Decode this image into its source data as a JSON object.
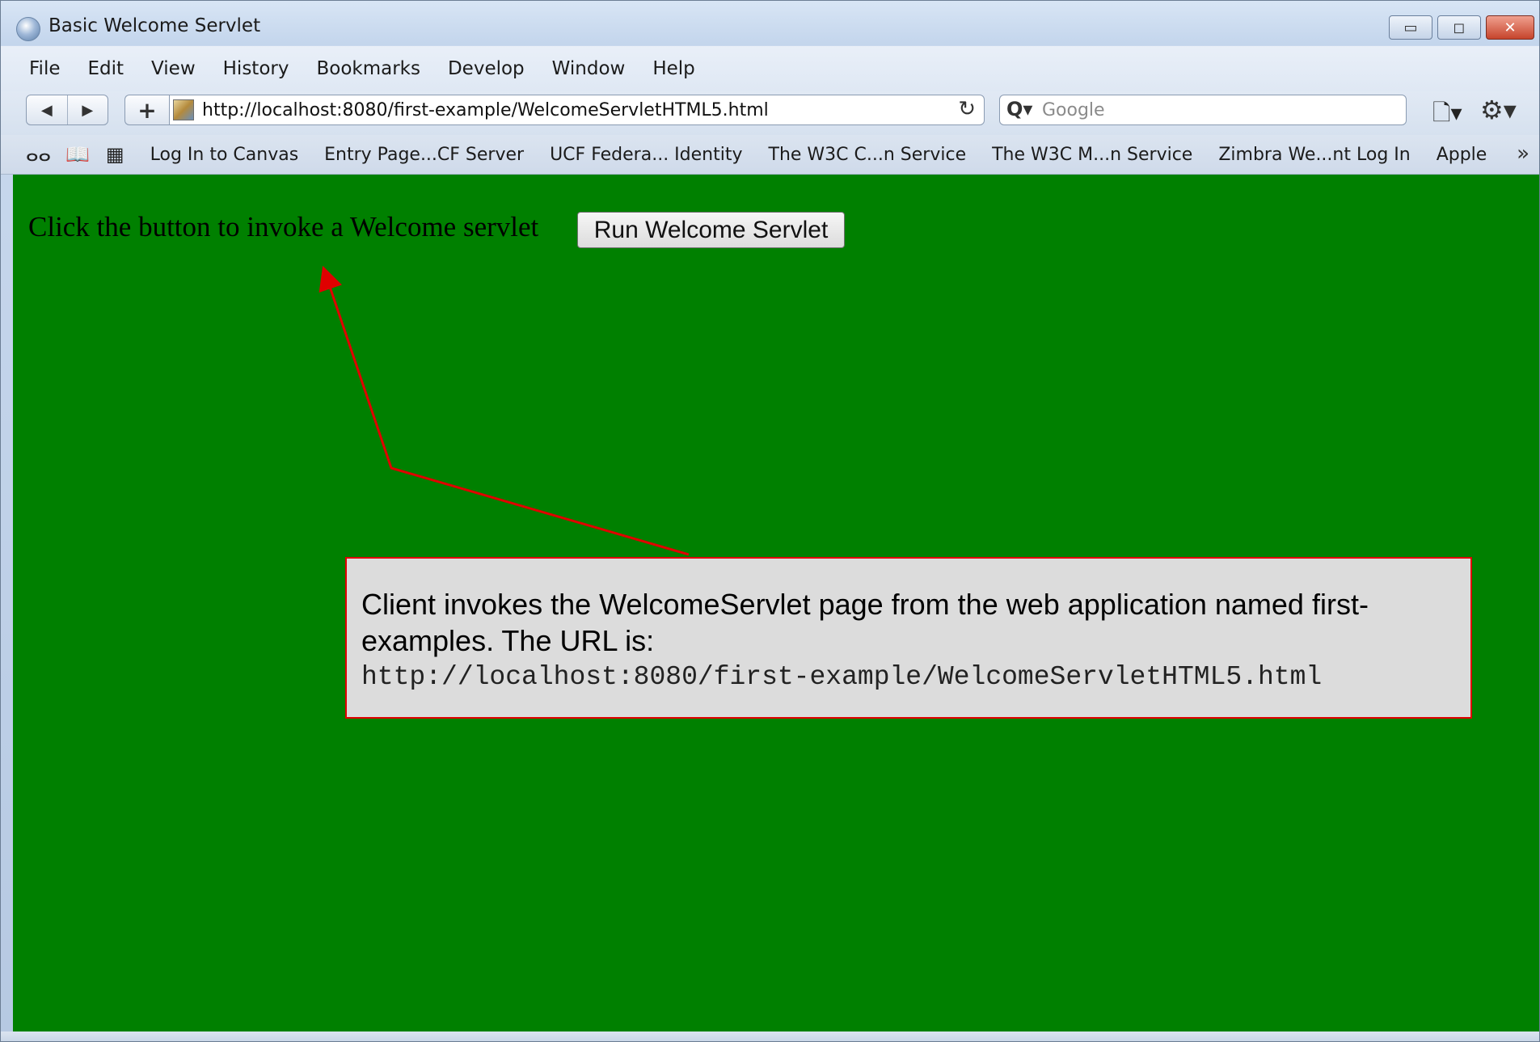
{
  "window": {
    "title": "Basic Welcome Servlet",
    "controls": {
      "minimize": "▭",
      "maximize": "◻",
      "close": "✕"
    }
  },
  "menu": [
    "File",
    "Edit",
    "View",
    "History",
    "Bookmarks",
    "Develop",
    "Window",
    "Help"
  ],
  "toolbar": {
    "back_icon": "◀",
    "forward_icon": "▶",
    "add_icon": "+",
    "url": "http://localhost:8080/first-example/WelcomeServletHTML5.html",
    "reload_icon": "↻",
    "search_placeholder": "Google",
    "search_icon": "Q▾",
    "page_menu_icon": "🗋▾",
    "settings_icon": "⚙▾"
  },
  "bookmarks": {
    "reading_list_icon": "ⴰⴰ",
    "bookmarks_icon": "📖",
    "top_sites_icon": "▦",
    "items": [
      "Log In to Canvas",
      "Entry Page...CF Server",
      "UCF Federa... Identity",
      "The W3C C...n Service",
      "The W3C M...n Service",
      "Zimbra We...nt Log In",
      "Apple"
    ],
    "more_icon": "»"
  },
  "page": {
    "prompt": "Click the button to invoke a Welcome servlet",
    "button_label": "Run Welcome Servlet",
    "background_color": "#008000"
  },
  "annotation": {
    "text": "Client invokes the WelcomeServlet page from the web application named first-examples.  The URL is:",
    "url": "http://localhost:8080/first-example/WelcomeServletHTML5.html",
    "border_color": "#e00000",
    "arrow_color": "#e00000"
  }
}
